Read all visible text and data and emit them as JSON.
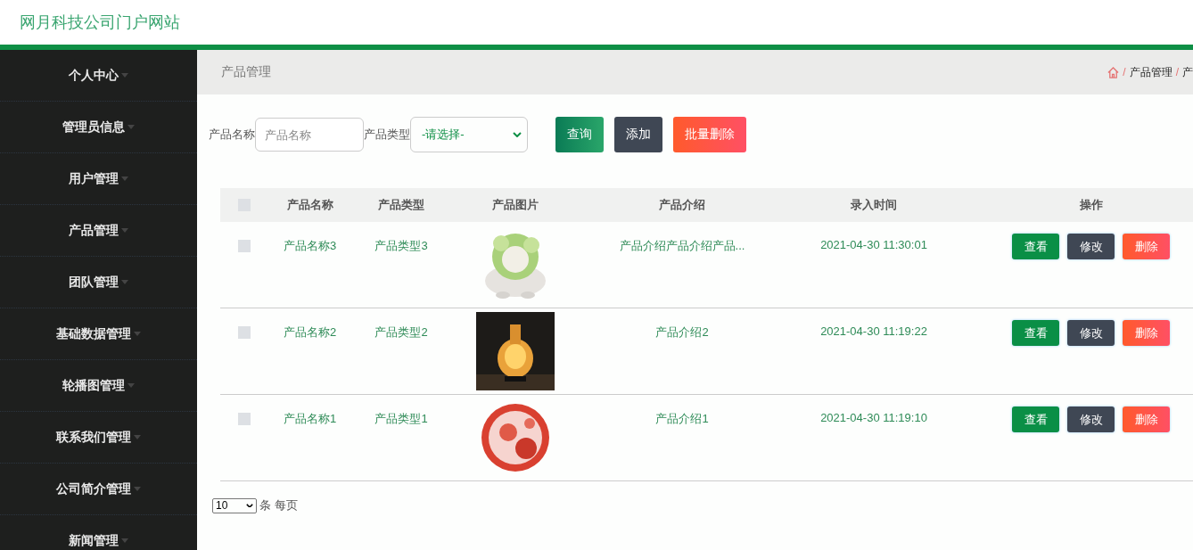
{
  "header": {
    "title": "网月科技公司门户网站"
  },
  "sidebar": {
    "items": [
      {
        "label": "个人中心"
      },
      {
        "label": "管理员信息"
      },
      {
        "label": "用户管理"
      },
      {
        "label": "产品管理"
      },
      {
        "label": "团队管理"
      },
      {
        "label": "基础数据管理"
      },
      {
        "label": "轮播图管理"
      },
      {
        "label": "联系我们管理"
      },
      {
        "label": "公司简介管理"
      },
      {
        "label": "新闻管理"
      }
    ]
  },
  "page_title": "产品管理",
  "breadcrumb": {
    "separator": "/",
    "items": [
      "产品管理",
      "产"
    ]
  },
  "search": {
    "name_label": "产品名称",
    "name_placeholder": "产品名称",
    "type_label": "产品类型",
    "type_value": "-请选择-",
    "buttons": [
      {
        "label": "查询",
        "kind": "search"
      },
      {
        "label": "添加",
        "kind": "add"
      },
      {
        "label": "批量删除",
        "kind": "danger"
      }
    ]
  },
  "table": {
    "columns": [
      "产品名称",
      "产品类型",
      "产品图片",
      "产品介绍",
      "录入时间",
      "操作"
    ],
    "header_checked": false,
    "rows": [
      {
        "checked": false,
        "name": "产品名称3",
        "type": "产品类型3",
        "intro": "产品介绍产品介绍产品...",
        "time": "2021-04-30 11:30:01",
        "actions": [
          "查看",
          "修改",
          "删除"
        ]
      },
      {
        "checked": false,
        "name": "产品名称2",
        "type": "产品类型2",
        "intro": "产品介绍2",
        "time": "2021-04-30 11:19:22",
        "actions": [
          "查看",
          "修改",
          "删除"
        ]
      },
      {
        "checked": false,
        "name": "产品名称1",
        "type": "产品类型1",
        "intro": "产品介绍1",
        "time": "2021-04-30 11:19:10",
        "actions": [
          "查看",
          "修改",
          "删除"
        ]
      }
    ]
  },
  "pagination": {
    "page_size": "10",
    "label": "条 每页"
  }
}
